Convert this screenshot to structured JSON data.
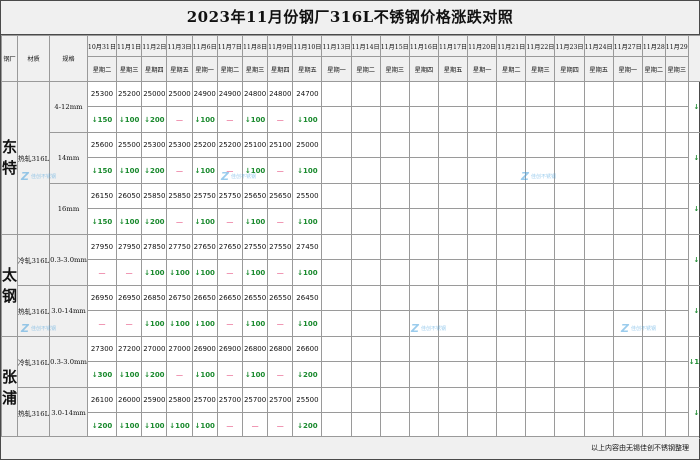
{
  "title": "2023年11月份钢厂316L不锈钢价格涨跌对照",
  "header": {
    "mill": "钢厂",
    "grade": "材质",
    "spec": "规格",
    "month_col": "",
    "dates": [
      "10月31日",
      "11月1日",
      "11月2日",
      "11月3日",
      "11月6日",
      "11月7日",
      "11月8日",
      "11月9日",
      "11月10日",
      "11月13日",
      "11月14日",
      "11月15日",
      "11月16日",
      "11月17日",
      "11月20日",
      "11月21日",
      "11月22日",
      "11月23日",
      "11月24日",
      "11月27日",
      "11月28",
      "11月29"
    ],
    "weekdays": [
      "星期二",
      "星期三",
      "星期四",
      "星期五",
      "星期一",
      "星期二",
      "星期三",
      "星期四",
      "星期五",
      "星期一",
      "星期二",
      "星期三",
      "星期四",
      "星期五",
      "星期一",
      "星期二",
      "星期三",
      "星期四",
      "星期五",
      "星期一",
      "星期二",
      "星期三"
    ]
  },
  "mills": [
    {
      "name": "东特",
      "groups": [
        {
          "grade": "热轧316L",
          "rows": [
            {
              "spec": "4-12mm",
              "prices": [
                "25300",
                "25200",
                "25000",
                "25000",
                "24900",
                "24900",
                "24800",
                "24800",
                "24700"
              ],
              "changes": [
                "↓150",
                "↓100",
                "↓200",
                "—",
                "↓100",
                "—",
                "↓100",
                "—",
                "↓100"
              ],
              "month": "↓750"
            },
            {
              "spec": "14mm",
              "prices": [
                "25600",
                "25500",
                "25300",
                "25300",
                "25200",
                "25200",
                "25100",
                "25100",
                "25000"
              ],
              "changes": [
                "↓150",
                "↓100",
                "↓200",
                "—",
                "↓100",
                "—",
                "↓100",
                "—",
                "↓100"
              ],
              "month": "↓750"
            },
            {
              "spec": "16mm",
              "prices": [
                "26150",
                "26050",
                "25850",
                "25850",
                "25750",
                "25750",
                "25650",
                "25650",
                "25500"
              ],
              "changes": [
                "↓150",
                "↓100",
                "↓200",
                "—",
                "↓100",
                "—",
                "↓100",
                "—",
                "↓100"
              ],
              "month": "↓750"
            }
          ]
        }
      ]
    },
    {
      "name": "太钢",
      "groups": [
        {
          "grade": "冷轧316L",
          "rows": [
            {
              "spec": "0.3-3.0mm",
              "prices": [
                "27950",
                "27950",
                "27850",
                "27750",
                "27650",
                "27650",
                "27550",
                "27550",
                "27450"
              ],
              "changes": [
                "—",
                "—",
                "↓100",
                "↓100",
                "↓100",
                "—",
                "↓100",
                "—",
                "↓100"
              ],
              "month": "↓500"
            }
          ]
        },
        {
          "grade": "热轧316L",
          "rows": [
            {
              "spec": "3.0-14mm",
              "prices": [
                "26950",
                "26950",
                "26850",
                "26750",
                "26650",
                "26650",
                "26550",
                "26550",
                "26450"
              ],
              "changes": [
                "—",
                "—",
                "↓100",
                "↓100",
                "↓100",
                "—",
                "↓100",
                "—",
                "↓100"
              ],
              "month": "↓500"
            }
          ]
        }
      ]
    },
    {
      "name": "张浦",
      "groups": [
        {
          "grade": "冷轧316L",
          "rows": [
            {
              "spec": "0.3-3.0mm",
              "prices": [
                "27300",
                "27200",
                "27000",
                "27000",
                "26900",
                "26900",
                "26800",
                "26800",
                "26600"
              ],
              "changes": [
                "↓300",
                "↓100",
                "↓200",
                "—",
                "↓100",
                "—",
                "↓100",
                "—",
                "↓200"
              ],
              "month": "↓1000"
            }
          ]
        },
        {
          "grade": "热轧316L",
          "rows": [
            {
              "spec": "3.0-14mm",
              "prices": [
                "26100",
                "26000",
                "25900",
                "25800",
                "25700",
                "25700",
                "25700",
                "25700",
                "25500"
              ],
              "changes": [
                "↓200",
                "↓100",
                "↓100",
                "↓100",
                "↓100",
                "—",
                "—",
                "—",
                "↓200"
              ],
              "month": "↓800"
            }
          ]
        }
      ]
    }
  ],
  "footer": "以上内容由无锡佳创不锈钢整理",
  "watermark": {
    "logo": "Z",
    "text": "佳创不锈钢"
  },
  "colors": {
    "down": "#1a8a2e",
    "flat": "#e0306a",
    "header_bg": "#f0f0f0"
  }
}
